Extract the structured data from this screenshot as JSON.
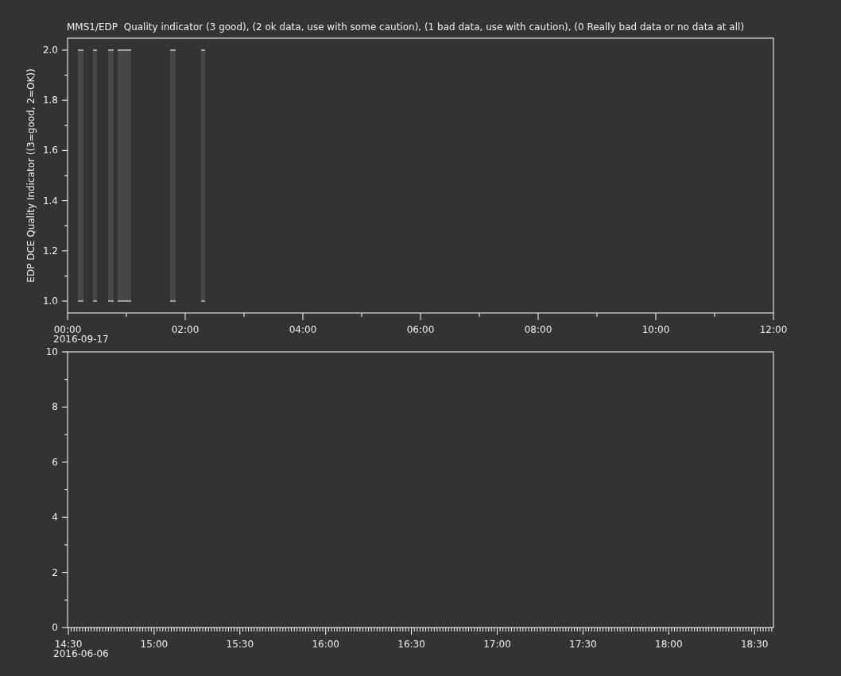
{
  "title": "MMS1/EDP  Quality indicator (3 good), (2 ok data, use with some caution), (1 bad data, use with caution), (0 Really bad data or no data at all)",
  "panels": [
    {
      "kind": "interval-plot",
      "ylabel": "EDP DCE Quality Indicator ((3=good, 2=OK))",
      "date_label": "2016-09-17",
      "x_tick_labels": [
        "00:00",
        "02:00",
        "04:00",
        "06:00",
        "08:00",
        "10:00",
        "12:00"
      ],
      "y_tick_labels": [
        "2.0",
        "1.8",
        "1.6",
        "1.4",
        "1.2",
        "1.0"
      ]
    },
    {
      "kind": "empty-plot",
      "date_label": "2016-06-06",
      "x_tick_labels": [
        "14:30",
        "15:00",
        "15:30",
        "16:00",
        "16:30",
        "17:00",
        "17:30",
        "18:00",
        "18:30"
      ],
      "y_tick_labels": [
        "10",
        "8",
        "6",
        "4",
        "2",
        "0"
      ]
    }
  ]
}
